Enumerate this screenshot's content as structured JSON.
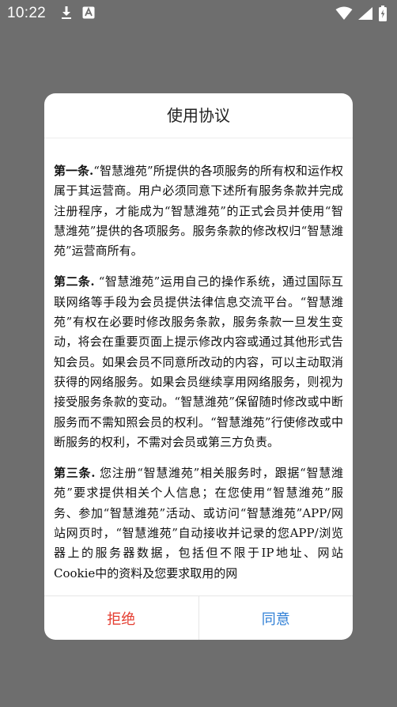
{
  "status_bar": {
    "time": "10:22",
    "left_icons": [
      "download-icon",
      "a-text-icon"
    ],
    "right_icons": [
      "wifi-icon",
      "signal-icon",
      "battery-icon"
    ]
  },
  "dialog": {
    "title": "使用协议",
    "clauses": [
      {
        "head": "第一条.",
        "text": "“智慧潍苑”所提供的各项服务的所有权和运作权属于其运营商。用户必须同意下述所有服务条款并完成注册程序，才能成为“智慧潍苑”的正式会员并使用“智慧潍苑”提供的各项服务。服务条款的修改权归“智慧潍苑”运营商所有。"
      },
      {
        "head": "第二条.",
        "text": " “智慧潍苑”运用自己的操作系统，通过国际互联网络等手段为会员提供法律信息交流平台。“智慧潍苑”有权在必要时修改服务条款，服务条款一旦发生变动，将会在重要页面上提示修改内容或通过其他形式告知会员。如果会员不同意所改动的内容，可以主动取消获得的网络服务。如果会员继续享用网络服务，则视为接受服务条款的变动。“智慧潍苑”保留随时修改或中断服务而不需知照会员的权利。“智慧潍苑”行使修改或中断服务的权利，不需对会员或第三方负责。"
      },
      {
        "head": "第三条.",
        "text": " 您注册“智慧潍苑”相关服务时，跟据“智慧潍苑”要求提供相关个人信息；在您使用“智慧潍苑”服务、参加“智慧潍苑”活动、或访问“智慧潍苑”APP/网站网页时，“智慧潍苑”自动接收并记录的您APP/浏览器上的服务器数据，包括但不限于IP地址、网站Cookie中的资料及您要求取用的网"
      }
    ],
    "reject_label": "拒绝",
    "agree_label": "同意"
  },
  "colors": {
    "backdrop": "#6e6e6e",
    "reject": "#e43d30",
    "agree": "#2f7fd6"
  }
}
